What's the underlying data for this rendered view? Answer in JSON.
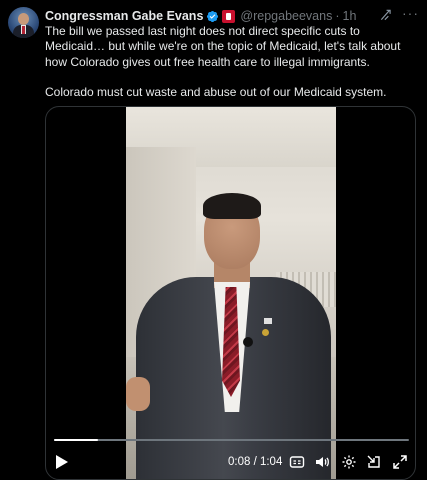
{
  "author": {
    "name": "Congressman Gabe Evans",
    "handle": "@repgabeevans",
    "time": "1h",
    "separator": "·"
  },
  "icons": {
    "avatar": "profile-photo",
    "verified": "verified-badge-icon",
    "affiliation": "government-flag-badge-icon",
    "grok": "grok-icon",
    "more": "more-options-icon",
    "play": "play-icon",
    "captions": "captions-icon",
    "volume": "volume-icon",
    "settings": "settings-gear-icon",
    "popout": "pop-out-icon",
    "fullscreen": "fullscreen-icon"
  },
  "tweet": {
    "paragraph1": "The bill we passed last night does not direct specific cuts to Medicaid… but while we're on the topic of Medicaid, let's talk about how Colorado gives out free health care to illegal immigrants.",
    "paragraph2": "Colorado must cut waste and abuse out of our Medicaid system."
  },
  "video": {
    "timecode": "0:08 / 1:04",
    "progress_fraction": 0.125
  },
  "colors": {
    "background": "#000000",
    "text": "#e7e9ea",
    "secondary": "#71767b",
    "verified": "#1d9bf0",
    "border": "#2f3336"
  },
  "more_glyph": "···"
}
